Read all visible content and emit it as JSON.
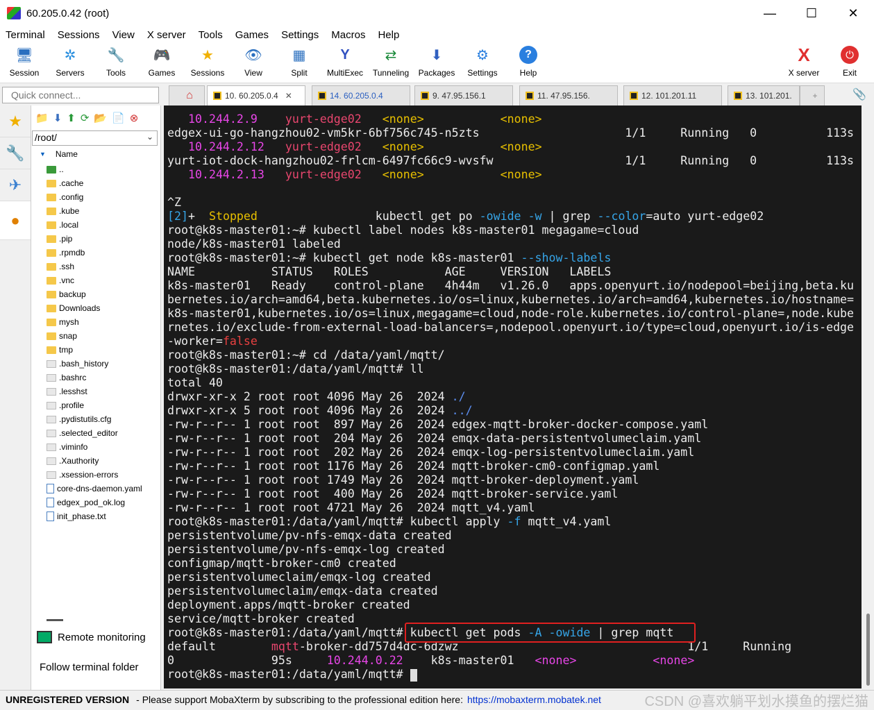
{
  "window": {
    "title": "60.205.0.42 (root)",
    "controls": [
      "—",
      "☐",
      "✕"
    ]
  },
  "menu": [
    "Terminal",
    "Sessions",
    "View",
    "X server",
    "Tools",
    "Games",
    "Settings",
    "Macros",
    "Help"
  ],
  "toolbar": [
    {
      "label": "Session",
      "icon": "session-icon",
      "glyph": "🖥"
    },
    {
      "label": "Servers",
      "icon": "servers-icon",
      "glyph": "✲"
    },
    {
      "label": "Tools",
      "icon": "tools-icon",
      "glyph": "🔧"
    },
    {
      "label": "Games",
      "icon": "games-icon",
      "glyph": "🎮"
    },
    {
      "label": "Sessions",
      "icon": "sessions-star-icon",
      "glyph": "★"
    },
    {
      "label": "View",
      "icon": "view-icon",
      "glyph": "👁"
    },
    {
      "label": "Split",
      "icon": "split-icon",
      "glyph": "▦"
    },
    {
      "label": "MultiExec",
      "icon": "multiexec-icon",
      "glyph": "Y"
    },
    {
      "label": "Tunneling",
      "icon": "tunneling-icon",
      "glyph": "⇄"
    },
    {
      "label": "Packages",
      "icon": "packages-icon",
      "glyph": "⬇"
    },
    {
      "label": "Settings",
      "icon": "settings-icon",
      "glyph": "⚙"
    },
    {
      "label": "Help",
      "icon": "help-icon",
      "glyph": "?"
    },
    {
      "label": "X server",
      "icon": "x-server-icon",
      "glyph": "X"
    },
    {
      "label": "Exit",
      "icon": "exit-icon",
      "glyph": "⏻"
    }
  ],
  "quick_connect": {
    "placeholder": "Quick connect..."
  },
  "tabs": [
    {
      "label": "10. 60.205.0.4",
      "active": true
    },
    {
      "label": "14. 60.205.0.4",
      "active": false
    },
    {
      "label": "9. 47.95.156.1",
      "active": false
    },
    {
      "label": "11. 47.95.156.",
      "active": false
    },
    {
      "label": "12. 101.201.11",
      "active": false
    },
    {
      "label": "13. 101.201.",
      "active": false
    }
  ],
  "sidebar": {
    "path": "/root/",
    "column_header": "Name",
    "files": [
      {
        "name": "..",
        "type": "up"
      },
      {
        "name": ".cache",
        "type": "folder"
      },
      {
        "name": ".config",
        "type": "folder"
      },
      {
        "name": ".kube",
        "type": "folder"
      },
      {
        "name": ".local",
        "type": "folder"
      },
      {
        "name": ".pip",
        "type": "folder"
      },
      {
        "name": ".rpmdb",
        "type": "folder"
      },
      {
        "name": ".ssh",
        "type": "folder"
      },
      {
        "name": ".vnc",
        "type": "folder"
      },
      {
        "name": "backup",
        "type": "folder"
      },
      {
        "name": "Downloads",
        "type": "folder"
      },
      {
        "name": "mysh",
        "type": "folder"
      },
      {
        "name": "snap",
        "type": "folder"
      },
      {
        "name": "tmp",
        "type": "folder"
      },
      {
        "name": ".bash_history",
        "type": "hidden"
      },
      {
        "name": ".bashrc",
        "type": "hidden"
      },
      {
        "name": ".lesshst",
        "type": "hidden"
      },
      {
        "name": ".profile",
        "type": "hidden"
      },
      {
        "name": ".pydistutils.cfg",
        "type": "hidden"
      },
      {
        "name": ".selected_editor",
        "type": "hidden"
      },
      {
        "name": ".viminfo",
        "type": "hidden"
      },
      {
        "name": ".Xauthority",
        "type": "hidden"
      },
      {
        "name": ".xsession-errors",
        "type": "hidden"
      },
      {
        "name": "core-dns-daemon.yaml",
        "type": "doc"
      },
      {
        "name": "edgex_pod_ok.log",
        "type": "doc"
      },
      {
        "name": "init_phase.txt",
        "type": "doc"
      }
    ],
    "remote_monitoring": "Remote monitoring",
    "follow_terminal_folder": "Follow terminal folder"
  },
  "terminal": {
    "lines": [
      [
        [
          "   ",
          ""
        ],
        [
          "10.244.2.9",
          "mag"
        ],
        [
          "    ",
          ""
        ],
        [
          "yurt-edge02",
          "pink"
        ],
        [
          "   ",
          ""
        ],
        [
          "<none>",
          "gold"
        ],
        [
          "           ",
          ""
        ],
        [
          "<none>",
          "gold"
        ]
      ],
      [
        [
          "edgex-ui-go-hangzhou02-vm5kr-6bf756c745-n5zts                     1/1     Running   0          113s",
          ""
        ]
      ],
      [
        [
          "   ",
          ""
        ],
        [
          "10.244.2.12",
          "mag"
        ],
        [
          "   ",
          ""
        ],
        [
          "yurt-edge02",
          "pink"
        ],
        [
          "   ",
          ""
        ],
        [
          "<none>",
          "gold"
        ],
        [
          "           ",
          ""
        ],
        [
          "<none>",
          "gold"
        ]
      ],
      [
        [
          "yurt-iot-dock-hangzhou02-frlcm-6497fc66c9-wvsfw                   1/1     Running   0          113s",
          ""
        ]
      ],
      [
        [
          "   ",
          ""
        ],
        [
          "10.244.2.13",
          "mag"
        ],
        [
          "   ",
          ""
        ],
        [
          "yurt-edge02",
          "pink"
        ],
        [
          "   ",
          ""
        ],
        [
          "<none>",
          "gold"
        ],
        [
          "           ",
          ""
        ],
        [
          "<none>",
          "gold"
        ]
      ],
      [
        [
          "",
          ""
        ]
      ],
      [
        [
          "^Z",
          ""
        ]
      ],
      [
        [
          "[2]",
          "cyan"
        ],
        [
          "+  ",
          ""
        ],
        [
          "Stopped",
          "gold"
        ],
        [
          "                 kubectl get po ",
          ""
        ],
        [
          "-owide",
          "cyan"
        ],
        [
          " ",
          ""
        ],
        [
          "-w",
          "cyan"
        ],
        [
          " | grep ",
          ""
        ],
        [
          "--color",
          "cyan"
        ],
        [
          "=auto yurt-edge02",
          ""
        ]
      ],
      [
        [
          "root@k8s-master01:~# kubectl label nodes k8s-master01 megagame=cloud",
          ""
        ]
      ],
      [
        [
          "node/k8s-master01 labeled",
          ""
        ]
      ],
      [
        [
          "root@k8s-master01:~# kubectl get node k8s-master01 ",
          ""
        ],
        [
          "--show-labels",
          "cyan"
        ]
      ],
      [
        [
          "NAME           STATUS   ROLES           AGE     VERSION   LABELS",
          ""
        ]
      ],
      [
        [
          "k8s-master01   Ready    control-plane   4h44m   v1.26.0   apps.openyurt.io/nodepool=beijing,beta.ku",
          ""
        ]
      ],
      [
        [
          "bernetes.io/arch=amd64,beta.kubernetes.io/os=linux,kubernetes.io/arch=amd64,kubernetes.io/hostname=",
          ""
        ]
      ],
      [
        [
          "k8s-master01,kubernetes.io/os=linux,megagame=cloud,node-role.kubernetes.io/control-plane=,node.kube",
          ""
        ]
      ],
      [
        [
          "rnetes.io/exclude-from-external-load-balancers=,nodepool.openyurt.io/type=cloud,openyurt.io/is-edge",
          ""
        ]
      ],
      [
        [
          "-worker=",
          ""
        ],
        [
          "false",
          "red"
        ]
      ],
      [
        [
          "root@k8s-master01:~# cd /data/yaml/mqtt/",
          ""
        ]
      ],
      [
        [
          "root@k8s-master01:/data/yaml/mqtt# ll",
          ""
        ]
      ],
      [
        [
          "total 40",
          ""
        ]
      ],
      [
        [
          "drwxr-xr-x 2 root root 4096 May 26  2024 ",
          ""
        ],
        [
          "./",
          "blue"
        ]
      ],
      [
        [
          "drwxr-xr-x 5 root root 4096 May 26  2024 ",
          ""
        ],
        [
          "../",
          "blue"
        ]
      ],
      [
        [
          "-rw-r--r-- 1 root root  897 May 26  2024 edgex-mqtt-broker-docker-compose.yaml",
          ""
        ]
      ],
      [
        [
          "-rw-r--r-- 1 root root  204 May 26  2024 emqx-data-persistentvolumeclaim.yaml",
          ""
        ]
      ],
      [
        [
          "-rw-r--r-- 1 root root  202 May 26  2024 emqx-log-persistentvolumeclaim.yaml",
          ""
        ]
      ],
      [
        [
          "-rw-r--r-- 1 root root 1176 May 26  2024 mqtt-broker-cm0-configmap.yaml",
          ""
        ]
      ],
      [
        [
          "-rw-r--r-- 1 root root 1749 May 26  2024 mqtt-broker-deployment.yaml",
          ""
        ]
      ],
      [
        [
          "-rw-r--r-- 1 root root  400 May 26  2024 mqtt-broker-service.yaml",
          ""
        ]
      ],
      [
        [
          "-rw-r--r-- 1 root root 4721 May 26  2024 mqtt_v4.yaml",
          ""
        ]
      ],
      [
        [
          "root@k8s-master01:/data/yaml/mqtt# kubectl apply ",
          ""
        ],
        [
          "-f",
          "cyan"
        ],
        [
          " mqtt_v4.yaml",
          ""
        ]
      ],
      [
        [
          "persistentvolume/pv-nfs-emqx-data created",
          ""
        ]
      ],
      [
        [
          "persistentvolume/pv-nfs-emqx-log created",
          ""
        ]
      ],
      [
        [
          "configmap/mqtt-broker-cm0 created",
          ""
        ]
      ],
      [
        [
          "persistentvolumeclaim/emqx-log created",
          ""
        ]
      ],
      [
        [
          "persistentvolumeclaim/emqx-data created",
          ""
        ]
      ],
      [
        [
          "deployment.apps/mqtt-broker created",
          ""
        ]
      ],
      [
        [
          "service/mqtt-broker created",
          ""
        ]
      ],
      [
        [
          "root@k8s-master01:/data/yaml/mqtt# kubectl get pods ",
          ""
        ],
        [
          "-A",
          "cyan"
        ],
        [
          " ",
          ""
        ],
        [
          "-owide",
          "cyan"
        ],
        [
          " | grep mqtt",
          ""
        ]
      ],
      [
        [
          "default        ",
          ""
        ],
        [
          "mqtt",
          "pink"
        ],
        [
          "-broker-dd757d4dc-6dzwz                                 1/1     Running",
          ""
        ]
      ],
      [
        [
          "0              95s     ",
          ""
        ],
        [
          "10.244.0.22",
          "mag"
        ],
        [
          "    k8s-master01   ",
          ""
        ],
        [
          "<none>",
          "mag"
        ],
        [
          "           ",
          ""
        ],
        [
          "<none>",
          "mag"
        ]
      ],
      [
        [
          "root@k8s-master01:/data/yaml/mqtt# ",
          ""
        ]
      ]
    ]
  },
  "status": {
    "unregistered": "UNREGISTERED VERSION",
    "message": "-  Please support MobaXterm by subscribing to the professional edition here:",
    "link": "https://mobaxterm.mobatek.net"
  },
  "watermark": "CSDN @喜欢躺平划水摸鱼的摆烂猫"
}
